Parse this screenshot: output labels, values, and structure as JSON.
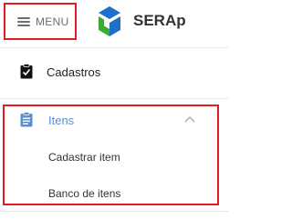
{
  "header": {
    "menu_label": "MENU",
    "brand": "SERAp",
    "logo_icon": "serap-logo-icon",
    "colors": {
      "logo_blue": "#1e6fc9",
      "logo_green": "#3aaa35"
    }
  },
  "nav": {
    "cadastros": {
      "label": "Cadastros",
      "icon": "clipboard-check-icon"
    },
    "itens": {
      "label": "Itens",
      "icon": "clipboard-list-icon",
      "expanded": true,
      "sub_items": [
        {
          "label": "Cadastrar item"
        },
        {
          "label": "Banco de itens"
        }
      ]
    }
  },
  "colors": {
    "highlight_border": "#e01b24",
    "active_text": "#5b8fd1"
  }
}
